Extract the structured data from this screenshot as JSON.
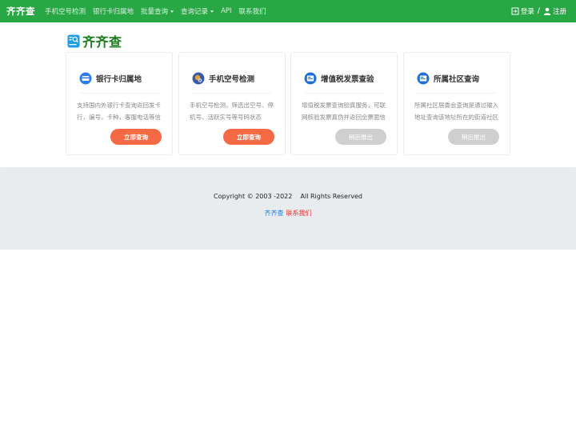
{
  "navbar": {
    "brand": "齐齐查",
    "items": [
      {
        "label": "手机空号检测",
        "has_caret": false
      },
      {
        "label": "银行卡归属地",
        "has_caret": false
      },
      {
        "label": "批量查询",
        "has_caret": true
      },
      {
        "label": "查询记录",
        "has_caret": true
      },
      {
        "label": "API",
        "has_caret": false
      },
      {
        "label": "联系我们",
        "has_caret": false
      }
    ],
    "login": {
      "label": "登录",
      "icon": "login-icon"
    },
    "separator": "/",
    "register": {
      "label": "注册",
      "icon": "user-icon"
    },
    "background_color": "#28a745"
  },
  "logo": {
    "text": "齐齐查",
    "icon": "logo-search-icon",
    "color": "#1a7a1a"
  },
  "cards": [
    {
      "title": "银行卡归属地",
      "icon": "bank-card-icon",
      "desc": "支持国内外银行卡查询返回发卡行，编号，卡种，客服电话等信息",
      "button": "立即查询",
      "enabled": true
    },
    {
      "title": "手机空号检测",
      "icon": "phone-check-icon",
      "desc": "手机空号检测，筛选出空号、停机号、活跃实号等号码状态",
      "button": "立即查询",
      "enabled": true
    },
    {
      "title": "增值税发票查验",
      "icon": "invoice-icon",
      "desc": "增值税发票查询验真服务，可联网核验发票真伪并返回全票面信息",
      "button": "稍后推出",
      "enabled": false
    },
    {
      "title": "所属社区查询",
      "icon": "community-icon",
      "desc": "所属社区居委会查询是通过输入地址查询该地址所在的街道社区",
      "button": "稍后推出",
      "enabled": false
    }
  ],
  "footer": {
    "copyright": "Copyright © 2003 -2022    All Rights Reserved",
    "site_link": "齐齐查",
    "contact_link": "联系我们"
  },
  "colors": {
    "accent_button": "#f56a44",
    "disabled_button": "#cfcfcf",
    "footer_bg": "#e9ecef"
  }
}
